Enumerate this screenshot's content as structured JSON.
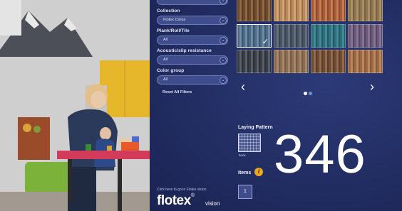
{
  "filters": [
    {
      "label": "Collection",
      "value": "Flotex Cirrus"
    },
    {
      "label": "Plank/Roll/Tile",
      "value": "All"
    },
    {
      "label": "Acoustic/slip resistance",
      "value": "All"
    },
    {
      "label": "Color group",
      "value": "All"
    }
  ],
  "reset_label": "Reset All Filters",
  "carousel": {
    "prev_icon": "chevron-left-icon",
    "next_icon": "chevron-right-icon",
    "prev": "‹",
    "next": "›",
    "active_page": 1,
    "page_count": 2
  },
  "tiles": [
    {
      "colors": [
        "#6b4a2e",
        "#8c6a47",
        "#5a3a22"
      ]
    },
    {
      "colors": [
        "#b88a5c",
        "#d1a575",
        "#9c7048"
      ]
    },
    {
      "colors": [
        "#a45c3a",
        "#c77b54",
        "#8a4a2c"
      ]
    },
    {
      "colors": [
        "#8d7650",
        "#a99166",
        "#786242"
      ]
    },
    {
      "colors": [
        "#4f6c86",
        "#6d8aa6",
        "#3b5670"
      ],
      "selected": true
    },
    {
      "colors": [
        "#4a5564",
        "#64707f",
        "#394351"
      ]
    },
    {
      "colors": [
        "#2f6f7a",
        "#3f8a94",
        "#245860"
      ]
    },
    {
      "colors": [
        "#6a5a78",
        "#857496",
        "#544660"
      ]
    },
    {
      "colors": [
        "#3a3f47",
        "#585e68",
        "#2a2e35"
      ]
    },
    {
      "colors": [
        "#8a6d52",
        "#a6876a",
        "#735a42"
      ]
    },
    {
      "colors": [
        "#6e4c34",
        "#8f6a4c",
        "#5a3c28"
      ]
    },
    {
      "colors": [
        "#9b6a44",
        "#b98760",
        "#855936"
      ]
    }
  ],
  "laying_pattern": {
    "label": "Laying Pattern",
    "name": "brick"
  },
  "count": "346",
  "items": {
    "label": "Items",
    "value": "1",
    "icon": "info-icon",
    "icon_glyph": "i"
  },
  "footer": {
    "link": "Click here to go to Flotex vision",
    "logo": "flotex",
    "logo_mark": "®",
    "logo_sub": "vision"
  },
  "colors": {
    "panel": "#222d62",
    "accent": "#f0a51c",
    "dot_active": "#ffffff",
    "dot_inactive": "#6f8fd6"
  }
}
